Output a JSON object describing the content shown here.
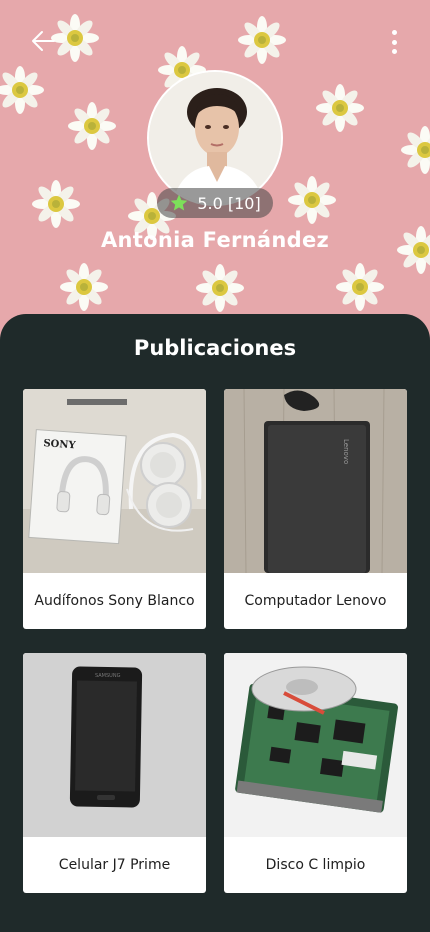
{
  "profile": {
    "name": "Antonia Fernández",
    "rating": "5.0 [10]"
  },
  "section_title": "Publicaciones",
  "items": [
    {
      "label": "Audífonos Sony Blanco"
    },
    {
      "label": "Computador Lenovo"
    },
    {
      "label": "Celular J7 Prime"
    },
    {
      "label": "Disco C limpio"
    }
  ],
  "icons": {
    "back": "arrow-left-icon",
    "menu": "more-vertical-icon",
    "star": "star-icon"
  },
  "colors": {
    "panel_bg": "#1f2a2a",
    "header_bg": "#e6a8ab",
    "star": "#7de05a"
  }
}
